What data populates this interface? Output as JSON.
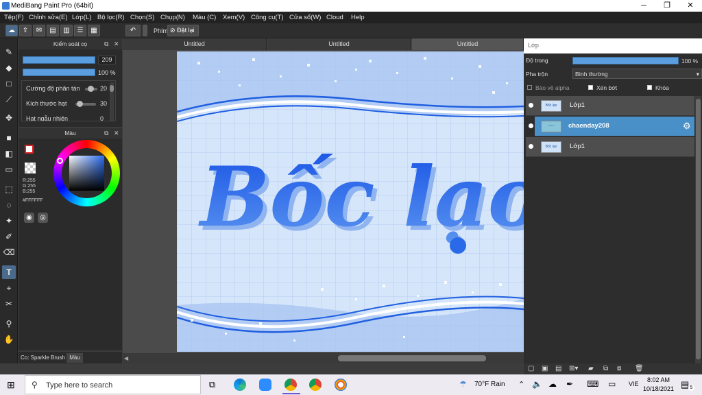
{
  "window": {
    "title": "MediBang Paint Pro (64bit)",
    "minimize": "─",
    "maximize": "❐",
    "close": "✕"
  },
  "menu": [
    "Tệp(F)",
    "Chỉnh sửa(E)",
    "Lớp(L)",
    "Bộ lọc(R)",
    "Chọn(S)",
    "Chụp(N)",
    "Màu (C)",
    "Xem(V)",
    "Công cụ(T)",
    "Cửa sổ(W)",
    "Cloud",
    "Help"
  ],
  "toolbar": {
    "keyboard_label": "Phím",
    "reset_label": "Đặt lại"
  },
  "brush_control": {
    "title": "Kiểm soát cọ",
    "size_value": "209",
    "opacity_value": "100 %",
    "props": [
      {
        "label": "Cường độ phân tán",
        "value": "20"
      },
      {
        "label": "Kích thước hạt",
        "value": "30"
      },
      {
        "label": "Hạt ngẫu nhiên",
        "value": "0"
      }
    ]
  },
  "color_panel": {
    "title": "Màu",
    "r": "R:255",
    "g": "G:255",
    "b": "B:255",
    "hex": "#FFFFFF"
  },
  "status": {
    "brush": "Co: Sparkle Brush",
    "tab": "Màu"
  },
  "canvas": {
    "tabs": [
      "Untitled",
      "Untitled",
      "Untitled"
    ],
    "active_tab": 2,
    "artwork_text": "Bốc lạo"
  },
  "layers": {
    "title": "Lớp",
    "opacity_label": "Độ trong",
    "opacity_value": "100 %",
    "blend_label": "Pha trộn",
    "blend_value": "Bình thường",
    "protect_alpha": "Bảo vệ alpha",
    "clipping": "Xén bớt",
    "lock": "Khóa",
    "items": [
      {
        "name": "Lớp1",
        "selected": false
      },
      {
        "name": "chaenday208",
        "selected": true
      },
      {
        "name": "Lớp1",
        "selected": false
      }
    ]
  },
  "taskbar": {
    "search_placeholder": "Type here to search",
    "weather": "70°F  Rain",
    "lang": "VIE",
    "time": "8:02 AM",
    "date": "10/18/2021",
    "notif_count": "5"
  },
  "colors": {
    "accent": "#4a90c8",
    "canvas_bg": "#c9dcf5",
    "text_blue": "#1f5fe0"
  }
}
